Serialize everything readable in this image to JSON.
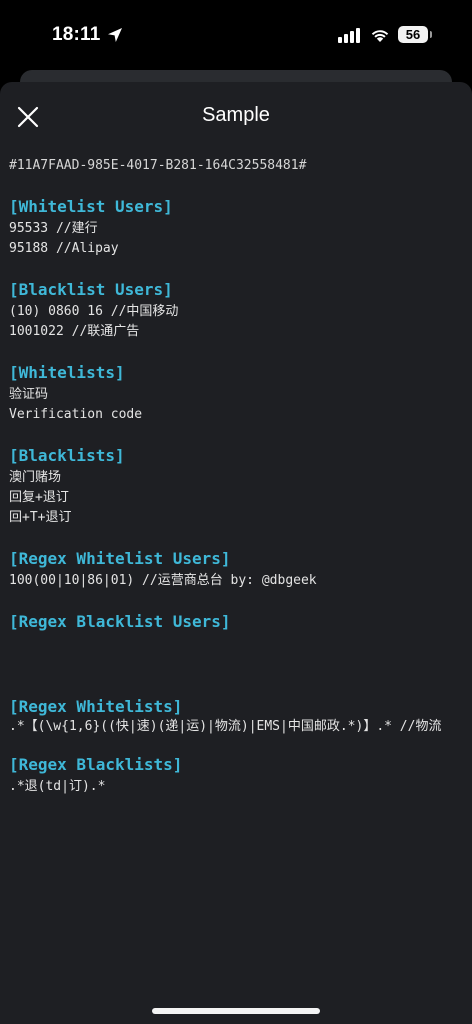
{
  "status_bar": {
    "time": "18:11",
    "battery": "56"
  },
  "sheet": {
    "title": "Sample"
  },
  "content": {
    "uuid": "#11A7FAAD-985E-4017-B281-164C32558481#",
    "sections": [
      {
        "header": "[Whitelist Users]",
        "lines": [
          "95533 //建行",
          "95188 //Alipay"
        ]
      },
      {
        "header": "[Blacklist Users]",
        "lines": [
          "(10) 0860 16 //中国移动",
          "1001022 //联通广告"
        ]
      },
      {
        "header": "[Whitelists]",
        "lines": [
          "验证码",
          "Verification code"
        ]
      },
      {
        "header": "[Blacklists]",
        "lines": [
          "澳门赌场",
          "回复+退订",
          "回+T+退订"
        ]
      },
      {
        "header": "[Regex Whitelist Users]",
        "lines": [
          "100(00|10|86|01) //运营商总台 by: @dbgeek"
        ]
      },
      {
        "header": "[Regex Blacklist Users]",
        "lines": []
      },
      {
        "header": "[Regex Whitelists]",
        "lines": [
          ".*【(\\w{1,6}((快|速)(递|运)|物流)|EMS|中国邮政.*)】.* //物流"
        ]
      },
      {
        "header": "[Regex Blacklists]",
        "lines": [
          ".*退(td|订).*"
        ]
      }
    ]
  },
  "icons": {
    "close": "close-icon",
    "location": "location-arrow-icon",
    "signal": "cellular-signal-icon",
    "wifi": "wifi-icon"
  },
  "colors": {
    "section_header": "#3fb8d8",
    "sheet_background": "#1e1f23"
  }
}
